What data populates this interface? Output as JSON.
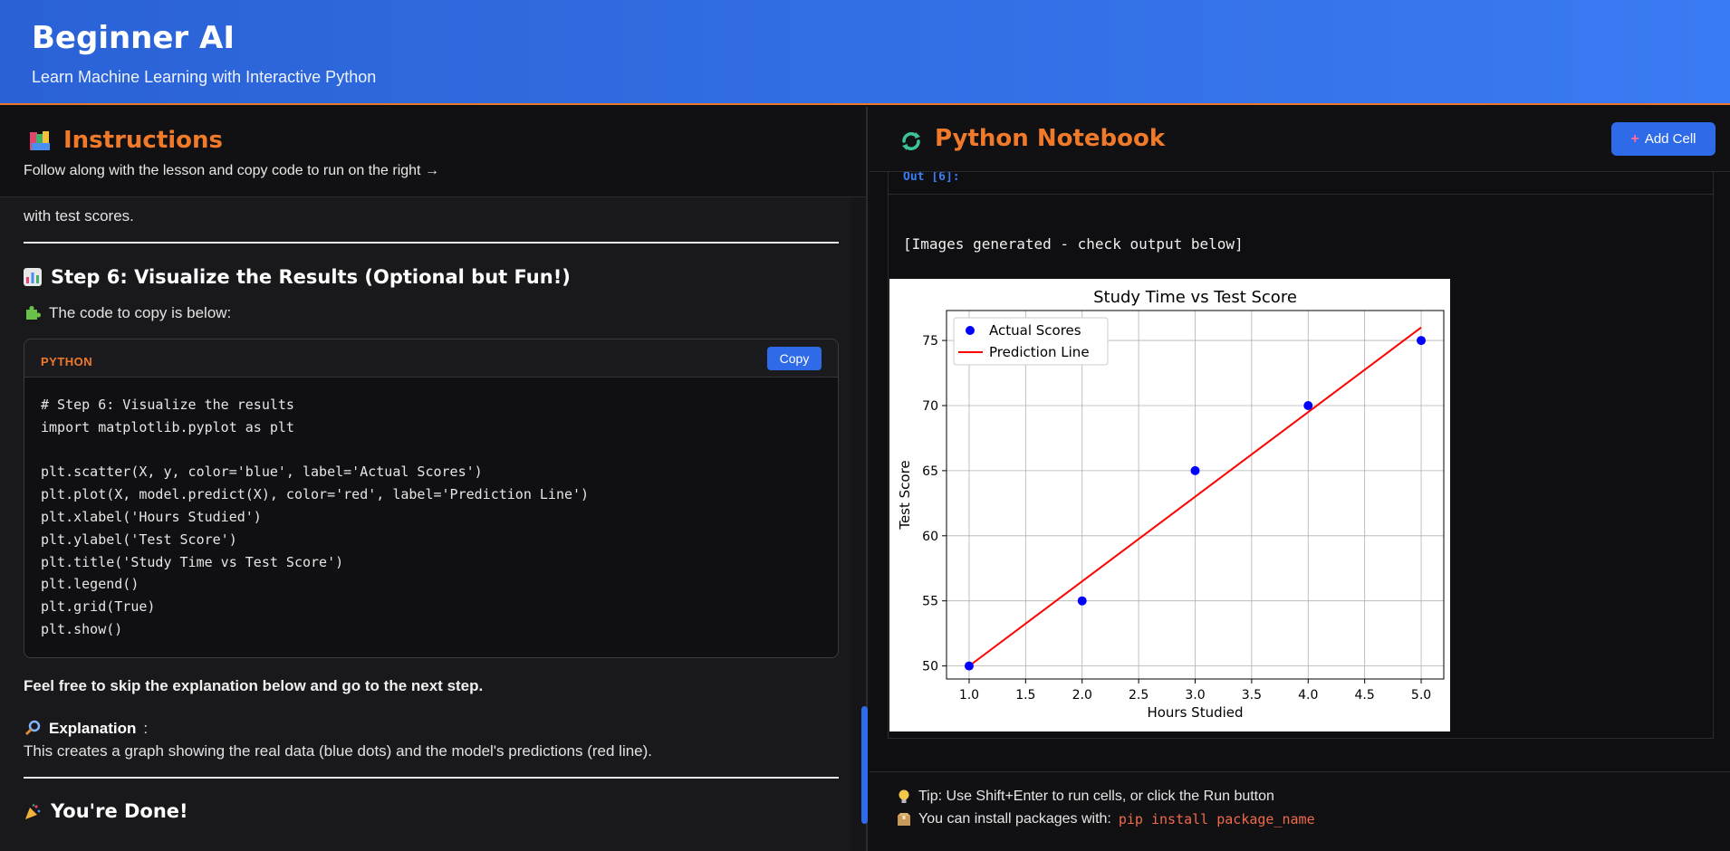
{
  "header": {
    "title": "Beginner AI",
    "subtitle": "Learn Machine Learning with Interactive Python"
  },
  "instructions": {
    "title": "Instructions",
    "subtitle": "Follow along with the lesson and copy code to run on the right →",
    "cut_text": "with test scores.",
    "step6_heading": "Step 6: Visualize the Results (Optional but Fun!)",
    "code_intro": "The code to copy is below:",
    "code_lang": "PYTHON",
    "copy_label": "Copy",
    "code": "# Step 6: Visualize the results\nimport matplotlib.pyplot as plt\n\nplt.scatter(X, y, color='blue', label='Actual Scores')\nplt.plot(X, model.predict(X), color='red', label='Prediction Line')\nplt.xlabel('Hours Studied')\nplt.ylabel('Test Score')\nplt.title('Study Time vs Test Score')\nplt.legend()\nplt.grid(True)\nplt.show()",
    "skip_note": "Feel free to skip the explanation below and go to the next step.",
    "explanation_label": "Explanation",
    "explanation_text": "This creates a graph showing the real data (blue dots) and the model's predictions (red line).",
    "done_heading": "You're Done!"
  },
  "notebook": {
    "title": "Python Notebook",
    "add_cell_label": "Add Cell",
    "out_label": "Out [6]:",
    "out_text": "[Images generated - check output below]",
    "tip_run": "Tip: Use Shift+Enter to run cells, or click the Run button",
    "tip_install": "You can install packages with:",
    "tip_install_cmd": "pip install package_name"
  },
  "chart_data": {
    "type": "scatter",
    "title": "Study Time vs Test Score",
    "xlabel": "Hours Studied",
    "ylabel": "Test Score",
    "xlim": [
      0.8,
      5.2
    ],
    "ylim": [
      49,
      77.3
    ],
    "xticks": [
      "1.0",
      "1.5",
      "2.0",
      "2.5",
      "3.0",
      "3.5",
      "4.0",
      "4.5",
      "5.0"
    ],
    "yticks": [
      "50",
      "55",
      "60",
      "65",
      "70",
      "75"
    ],
    "grid": true,
    "legend_position": "upper-left",
    "series": [
      {
        "name": "Actual Scores",
        "kind": "scatter",
        "color": "#0000ff",
        "x": [
          1,
          2,
          3,
          4,
          5
        ],
        "y": [
          50,
          55,
          65,
          70,
          75
        ]
      },
      {
        "name": "Prediction Line",
        "kind": "line",
        "color": "#ff0000",
        "x": [
          1,
          5
        ],
        "y": [
          50,
          76
        ]
      }
    ]
  },
  "colors": {
    "accent": "#f07a2a",
    "primary_button": "#2f6ae8",
    "header_gradient_start": "#2a62d6",
    "header_gradient_end": "#3a7af2"
  }
}
